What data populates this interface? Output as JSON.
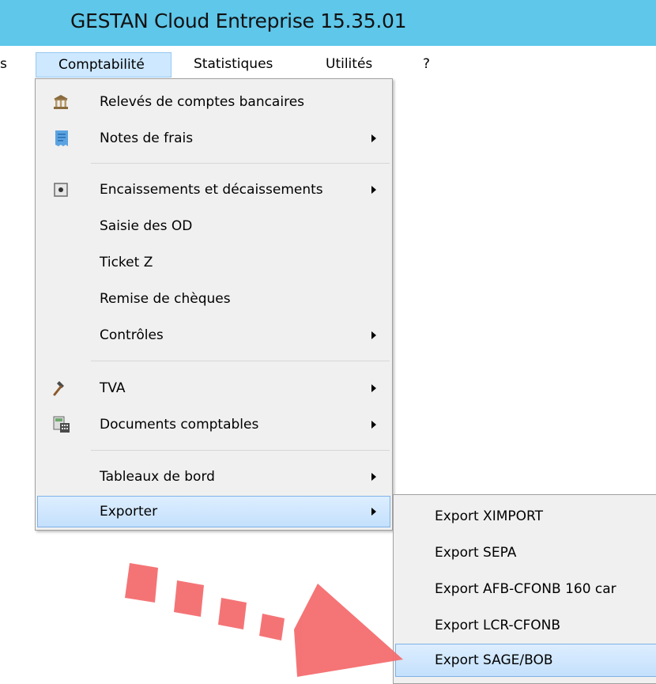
{
  "window": {
    "title": "GESTAN Cloud Entreprise 15.35.01"
  },
  "menubar": {
    "items": [
      {
        "label": "s"
      },
      {
        "label": "Comptabilité"
      },
      {
        "label": "Statistiques"
      },
      {
        "label": "Utilités"
      },
      {
        "label": "?"
      }
    ]
  },
  "comptabilite_menu": {
    "items": [
      {
        "label": "Relevés de comptes bancaires",
        "icon": "bank-icon"
      },
      {
        "label": "Notes de frais",
        "icon": "receipt-icon",
        "submenu": true
      },
      {
        "label": "Encaissements et décaissements",
        "icon": "cash-register-icon",
        "submenu": true
      },
      {
        "label": "Saisie des OD"
      },
      {
        "label": "Ticket Z"
      },
      {
        "label": "Remise de chèques"
      },
      {
        "label": "Contrôles",
        "submenu": true
      },
      {
        "label": "TVA",
        "icon": "hammer-icon",
        "submenu": true
      },
      {
        "label": "Documents comptables",
        "icon": "calculator-document-icon",
        "submenu": true
      },
      {
        "label": "Tableaux de bord",
        "submenu": true
      },
      {
        "label": "Exporter",
        "submenu": true,
        "highlighted": true
      }
    ]
  },
  "exporter_submenu": {
    "items": [
      {
        "label": "Export XIMPORT"
      },
      {
        "label": "Export SEPA"
      },
      {
        "label": "Export AFB-CFONB 160 car"
      },
      {
        "label": "Export LCR-CFONB"
      },
      {
        "label": "Export SAGE/BOB",
        "highlighted": true
      }
    ]
  },
  "colors": {
    "titlebar": "#5ec7ea",
    "menu_background": "#f0f0f0",
    "highlight": "#c4e0fc",
    "annotation_arrow": "#f46d6f"
  }
}
